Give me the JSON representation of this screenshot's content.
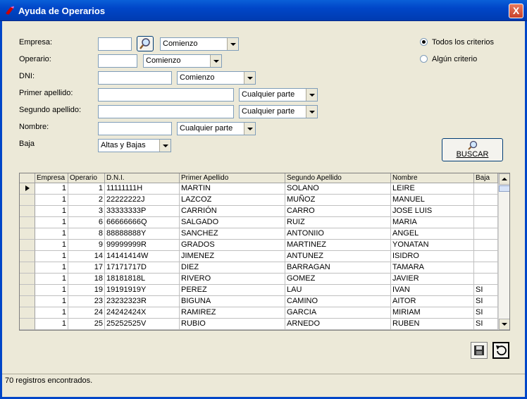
{
  "window": {
    "title": "Ayuda de Operarios",
    "close": "X"
  },
  "form": {
    "empresa_label": "Empresa:",
    "empresa_mode": "Comienzo",
    "operario_label": "Operario:",
    "operario_mode": "Comienzo",
    "dni_label": "DNI:",
    "dni_mode": "Comienzo",
    "apellido1_label": "Primer apellido:",
    "apellido1_mode": "Cualquier parte",
    "apellido2_label": "Segundo apellido:",
    "apellido2_mode": "Cualquier parte",
    "nombre_label": "Nombre:",
    "nombre_mode": "Cualquier parte",
    "baja_label": "Baja",
    "baja_value": "Altas y Bajas"
  },
  "criteria": {
    "all": "Todos los criterios",
    "any": "Algún criterio",
    "selected": "all"
  },
  "search_button": "BUSCAR",
  "table": {
    "columns": [
      "Empresa",
      "Operario",
      "D.N.I.",
      "Primer Apellido",
      "Segundo Apellido",
      "Nombre",
      "Baja"
    ],
    "rows": [
      [
        "1",
        "1",
        "11111111H",
        "MARTIN",
        "SOLANO",
        "LEIRE",
        ""
      ],
      [
        "1",
        "2",
        "22222222J",
        "LAZCOZ",
        "MUÑOZ",
        "MANUEL",
        ""
      ],
      [
        "1",
        "3",
        "33333333P",
        "CARRIÓN",
        "CARRO",
        "JOSE LUIS",
        ""
      ],
      [
        "1",
        "6",
        "66666666Q",
        "SALGADO",
        "RUIZ",
        "MARIA",
        ""
      ],
      [
        "1",
        "8",
        "88888888Y",
        "SANCHEZ",
        "ANTONIIO",
        "ANGEL",
        ""
      ],
      [
        "1",
        "9",
        "99999999R",
        "GRADOS",
        "MARTINEZ",
        "YONATAN",
        ""
      ],
      [
        "1",
        "14",
        "14141414W",
        "JIMENEZ",
        "ANTUNEZ",
        "ISIDRO",
        ""
      ],
      [
        "1",
        "17",
        "17171717D",
        "DIEZ",
        "BARRAGAN",
        "TAMARA",
        ""
      ],
      [
        "1",
        "18",
        "18181818L",
        "RIVERO",
        "GOMEZ",
        "JAVIER",
        ""
      ],
      [
        "1",
        "19",
        "19191919Y",
        "PEREZ",
        "LAU",
        "IVAN",
        "SI"
      ],
      [
        "1",
        "23",
        "23232323R",
        "BIGUNA",
        "CAMINO",
        "AITOR",
        "SI"
      ],
      [
        "1",
        "24",
        "24242424X",
        "RAMIREZ",
        "GARCIA",
        "MIRIAM",
        "SI"
      ],
      [
        "1",
        "25",
        "25252525V",
        "RUBIO",
        "ARNEDO",
        "RUBEN",
        "SI"
      ]
    ]
  },
  "status": "70 registros encontrados."
}
